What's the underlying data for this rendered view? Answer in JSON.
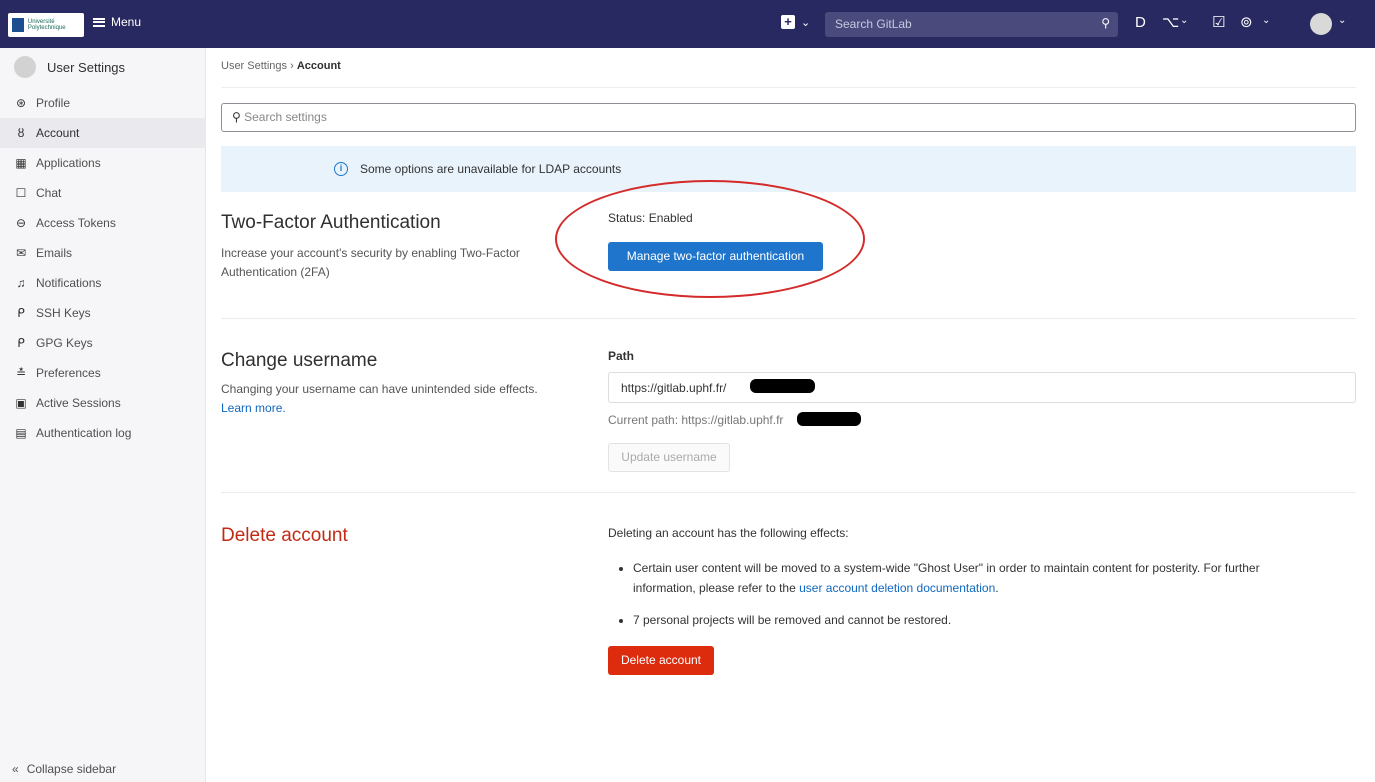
{
  "topbar": {
    "logo_text": "Université Polytechnique",
    "menu_label": "Menu",
    "search_placeholder": "Search GitLab"
  },
  "sidebar": {
    "title": "User Settings",
    "items": [
      {
        "label": "Profile",
        "icon": "profile-icon",
        "glyph": "⊛"
      },
      {
        "label": "Account",
        "icon": "account-icon",
        "glyph": "ȣ"
      },
      {
        "label": "Applications",
        "icon": "applications-icon",
        "glyph": "▦"
      },
      {
        "label": "Chat",
        "icon": "chat-icon",
        "glyph": "☐"
      },
      {
        "label": "Access Tokens",
        "icon": "token-icon",
        "glyph": "⊖"
      },
      {
        "label": "Emails",
        "icon": "email-icon",
        "glyph": "✉"
      },
      {
        "label": "Notifications",
        "icon": "bell-icon",
        "glyph": "♫"
      },
      {
        "label": "SSH Keys",
        "icon": "key-icon",
        "glyph": "ᑭ"
      },
      {
        "label": "GPG Keys",
        "icon": "key-icon",
        "glyph": "ᑭ"
      },
      {
        "label": "Preferences",
        "icon": "preferences-icon",
        "glyph": "≛"
      },
      {
        "label": "Active Sessions",
        "icon": "monitor-icon",
        "glyph": "▣"
      },
      {
        "label": "Authentication log",
        "icon": "log-icon",
        "glyph": "▤"
      }
    ],
    "active_index": 1,
    "collapse_label": "Collapse sidebar"
  },
  "breadcrumb": {
    "parent": "User Settings",
    "current": "Account"
  },
  "search_settings_placeholder": "Search settings",
  "banner_text": "Some options are unavailable for LDAP accounts",
  "two_factor": {
    "title": "Two-Factor Authentication",
    "description": "Increase your account's security by enabling Two-Factor Authentication (2FA)",
    "status": "Status: Enabled",
    "button": "Manage two-factor authentication"
  },
  "change_username": {
    "title": "Change username",
    "description": "Changing your username can have unintended side effects.",
    "learn_more": "Learn more.",
    "path_label": "Path",
    "path_prefix": "https://gitlab.uphf.fr/",
    "current_path": "Current path: https://gitlab.uphf.fr",
    "button": "Update username"
  },
  "delete_account": {
    "title": "Delete account",
    "intro": "Deleting an account has the following effects:",
    "bullet1_text": "Certain user content will be moved to a system-wide \"Ghost User\" in order to maintain content for posterity. For further information, please refer to the",
    "bullet1_link": "user account deletion documentation",
    "bullet2": "7 personal projects will be removed and cannot be restored.",
    "button": "Delete account"
  },
  "colors": {
    "topbar": "#292961",
    "primary": "#1f75cb",
    "danger": "#dd2b0e",
    "annotation": "#d42a2a"
  }
}
